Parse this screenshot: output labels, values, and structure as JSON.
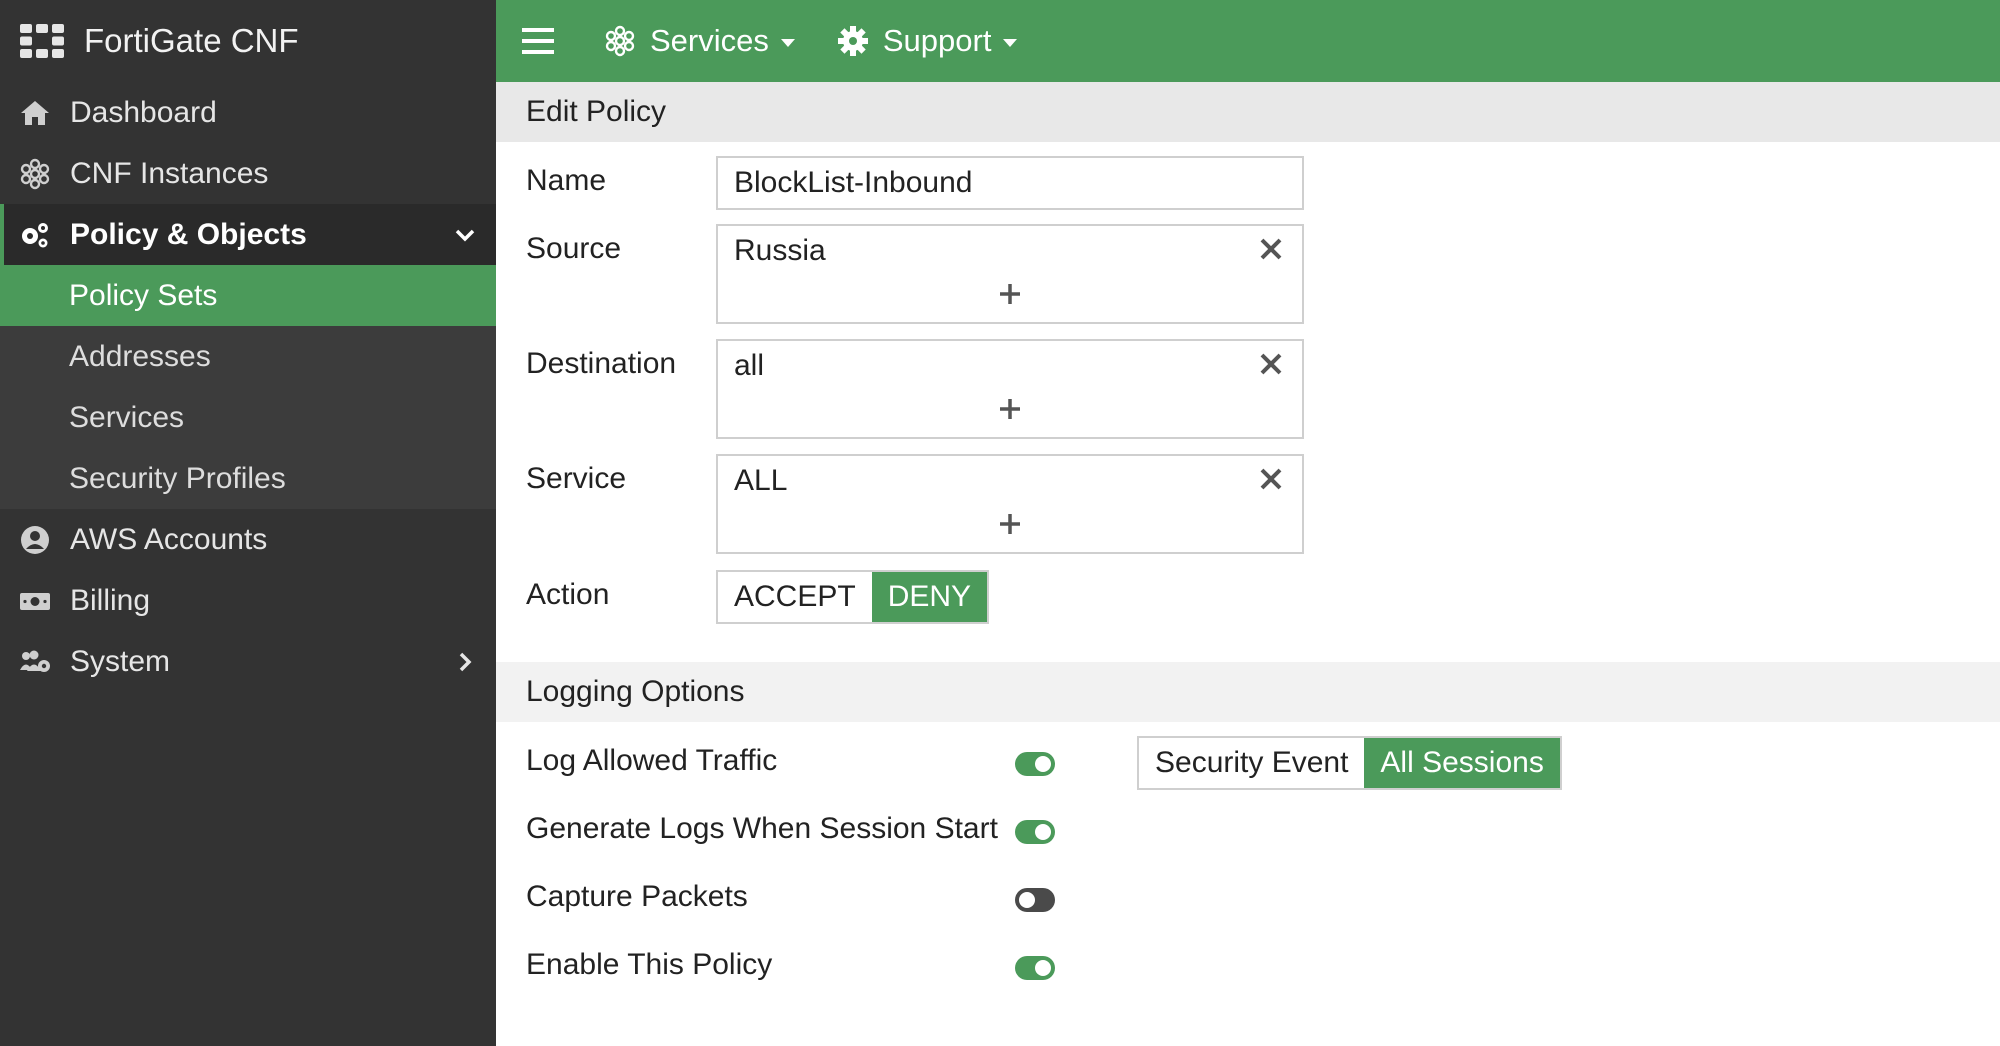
{
  "app": {
    "title": "FortiGate CNF"
  },
  "sidebar": {
    "items": [
      {
        "label": "Dashboard",
        "icon": "home-icon"
      },
      {
        "label": "CNF Instances",
        "icon": "instances-icon"
      },
      {
        "label": "Policy & Objects",
        "icon": "gears-icon",
        "expanded": true
      },
      {
        "label": "AWS Accounts",
        "icon": "user-circle-icon"
      },
      {
        "label": "Billing",
        "icon": "money-icon"
      },
      {
        "label": "System",
        "icon": "users-gear-icon"
      }
    ],
    "subitems": [
      {
        "label": "Policy Sets",
        "active": true
      },
      {
        "label": "Addresses"
      },
      {
        "label": "Services"
      },
      {
        "label": "Security Profiles"
      }
    ]
  },
  "topbar": {
    "menus": [
      {
        "label": "Services",
        "icon": "instances-icon"
      },
      {
        "label": "Support",
        "icon": "gear-icon"
      }
    ]
  },
  "edit_policy": {
    "header": "Edit Policy",
    "name": {
      "label": "Name",
      "value": "BlockList-Inbound"
    },
    "source": {
      "label": "Source",
      "value": "Russia"
    },
    "destination": {
      "label": "Destination",
      "value": "all"
    },
    "service": {
      "label": "Service",
      "value": "ALL"
    },
    "action": {
      "label": "Action",
      "options": [
        "ACCEPT",
        "DENY"
      ],
      "selected": "DENY"
    }
  },
  "logging": {
    "header": "Logging Options",
    "log_allowed_traffic": {
      "label": "Log Allowed Traffic",
      "enabled": true,
      "mode_options": [
        "Security Event",
        "All Sessions"
      ],
      "mode_selected": "All Sessions"
    },
    "generate_logs": {
      "label": "Generate Logs When Session Start",
      "enabled": true
    },
    "capture_packets": {
      "label": "Capture Packets",
      "enabled": false
    },
    "enable_policy": {
      "label": "Enable This Policy",
      "enabled": true
    }
  },
  "colors": {
    "accent": "#4b9a5a",
    "sidebar_bg": "#333333",
    "sidebar_sub_bg": "#3c3c3c"
  }
}
